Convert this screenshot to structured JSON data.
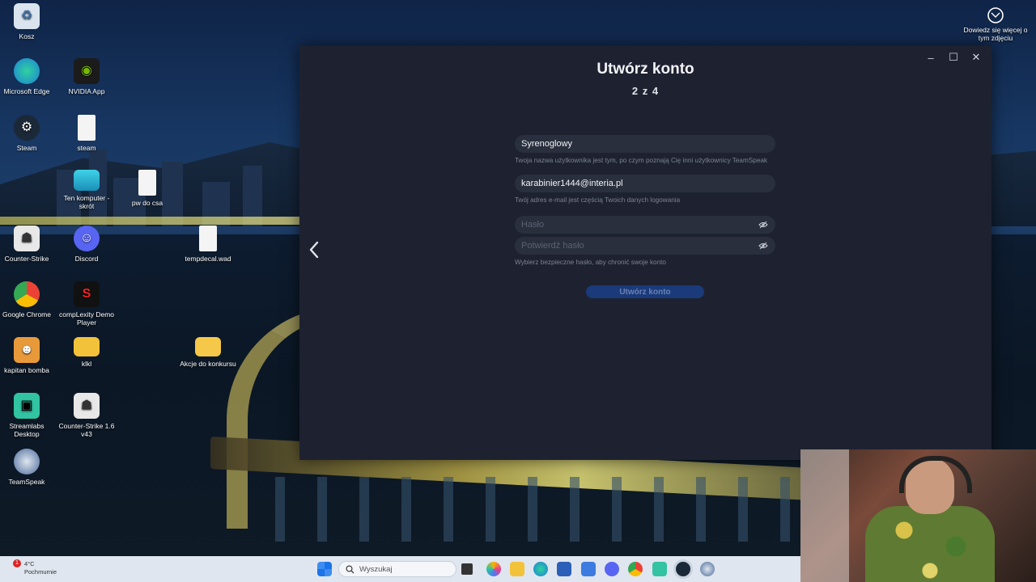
{
  "desktop": {
    "icons": [
      {
        "label": "Kosz",
        "icon": "recycle-bin-icon"
      },
      {
        "label": "Microsoft Edge",
        "icon": "edge-icon"
      },
      {
        "label": "NVIDIA App",
        "icon": "nvidia-icon"
      },
      {
        "label": "Steam",
        "icon": "steam-icon"
      },
      {
        "label": "steam",
        "icon": "file-icon"
      },
      {
        "label": "Ten komputer - skrót",
        "icon": "computer-icon"
      },
      {
        "label": "pw do csa",
        "icon": "file-icon"
      },
      {
        "label": "Counter-Strike",
        "icon": "counter-strike-icon"
      },
      {
        "label": "Discord",
        "icon": "discord-icon"
      },
      {
        "label": "tempdecal.wad",
        "icon": "file-icon"
      },
      {
        "label": "Google Chrome",
        "icon": "chrome-icon"
      },
      {
        "label": "compLexity Demo Player",
        "icon": "complexity-icon"
      },
      {
        "label": "kapitan bomba",
        "icon": "kapitan-bomba-icon"
      },
      {
        "label": "klkl",
        "icon": "folder-icon"
      },
      {
        "label": "Akcje do konkursu",
        "icon": "folder-icon"
      },
      {
        "label": "Streamlabs Desktop",
        "icon": "streamlabs-icon"
      },
      {
        "label": "Counter-Strike 1.6 v43",
        "icon": "counter-strike-icon"
      },
      {
        "label": "TeamSpeak",
        "icon": "teamspeak-icon"
      }
    ],
    "learn_more": "Dowiedz się więcej o tym zdjęciu"
  },
  "app": {
    "title": "Utwórz konto",
    "step": "2 z 4",
    "username": {
      "value": "Syrenoglowy",
      "hint": "Twoja nazwa użytkownika jest tym, po czym poznają Cię inni użytkownicy TeamSpeak"
    },
    "email": {
      "value": "karabinier1444@interia.pl",
      "hint": "Twój adres e-mail jest częścią Twoich danych logowania"
    },
    "password": {
      "placeholder": "Hasło"
    },
    "confirm_password": {
      "placeholder": "Potwierdź hasło",
      "hint": "Wybierz bezpieczne hasło, aby chronić swoje konto"
    },
    "submit_label": "Utwórz konto"
  },
  "taskbar": {
    "weather_badge": "1",
    "temperature": "4°C",
    "condition": "Pochmurnie",
    "search_placeholder": "Wyszukaj"
  },
  "colors": {
    "window_bg": "#1e2230",
    "field_bg": "#2a2f3d",
    "button_bg": "#1a3a7a",
    "taskbar_bg": "#dfe6ef"
  }
}
